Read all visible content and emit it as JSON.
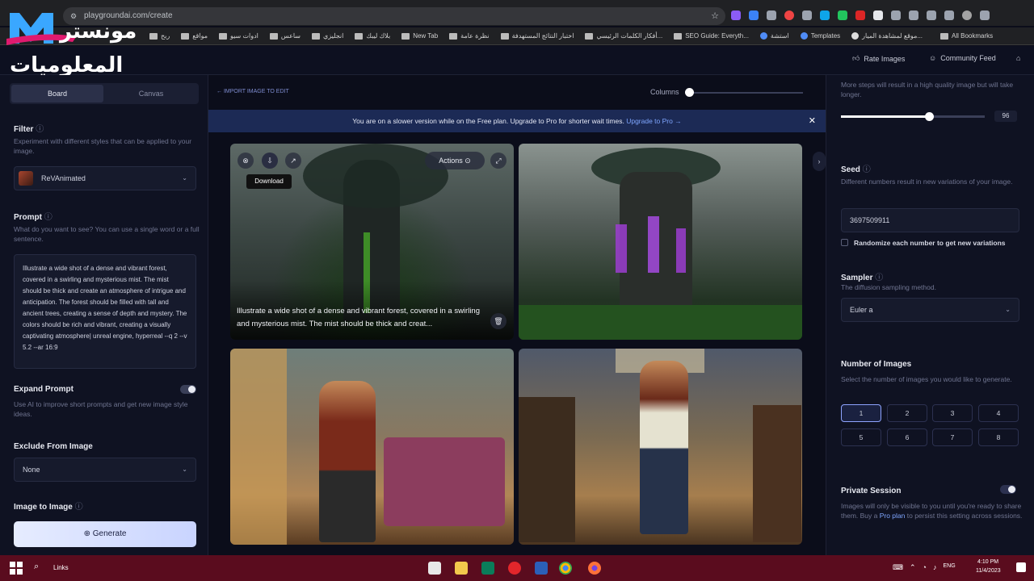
{
  "browser": {
    "url": "playgroundai.com/create",
    "bookmarks": [
      "ربح",
      "مواقع",
      "ادوات سيو",
      "ساعس",
      "انجليزي",
      "بلاك ليبك",
      "New Tab",
      "نظرة عامة",
      "اختبار النتائج المستهدفة",
      "أفكار الكلمات الرئيسي...",
      "SEO Guide: Everyth...",
      "استشة",
      "Templates",
      "موقع لمشاهدة الميار...",
      "All Bookmarks"
    ]
  },
  "logo": {
    "line1": "مونستر",
    "line2": "المعلوميات"
  },
  "header": {
    "rate_images": "Rate Images",
    "community_feed": "Community Feed"
  },
  "left": {
    "tabs": {
      "board": "Board",
      "canvas": "Canvas"
    },
    "filter": {
      "label": "Filter",
      "desc": "Experiment with different styles that can be applied to your image.",
      "value": "ReVAnimated"
    },
    "prompt": {
      "label": "Prompt",
      "desc": "What do you want to see? You can use a single word or a full sentence.",
      "text": "Illustrate a wide shot of a dense and vibrant forest, covered in a swirling and mysterious mist. The mist should be thick and create an atmosphere of intrigue and anticipation. The forest should be filled with tall and ancient trees, creating a sense of depth and mystery. The colors should be rich and vibrant, creating a visually captivating atmosphere| unreal engine, hyperreal --q 2 --v 5.2 --ar 16:9"
    },
    "expand": {
      "label": "Expand Prompt",
      "desc": "Use AI to improve short prompts and get new image style ideas."
    },
    "exclude": {
      "label": "Exclude From Image",
      "value": "None"
    },
    "img2img": {
      "label": "Image to Image"
    },
    "generate": "Generate"
  },
  "center": {
    "import_link": "← IMPORT IMAGE TO EDIT",
    "columns_label": "Columns",
    "notice": "You are on a slower version while on the Free plan. Upgrade to Pro for shorter wait times.",
    "notice_link": "Upgrade to Pro →",
    "actions_label": "Actions",
    "tooltip": "Download",
    "caption": "Illustrate a wide shot of a dense and vibrant forest, covered in a swirling and mysterious mist. The mist should be thick and creat..."
  },
  "right": {
    "steps_desc": "More steps will result in a high quality image but will take longer.",
    "steps_value": "96",
    "seed": {
      "label": "Seed",
      "desc": "Different numbers result in new variations of your image.",
      "value": "3697509911",
      "randomize": "Randomize each number to get new variations"
    },
    "sampler": {
      "label": "Sampler",
      "desc": "The diffusion sampling method.",
      "value": "Euler a"
    },
    "num_images": {
      "label": "Number of Images",
      "desc": "Select the number of images you would like to generate.",
      "options": [
        "1",
        "2",
        "3",
        "4",
        "5",
        "6",
        "7",
        "8"
      ],
      "selected": "1"
    },
    "private": {
      "label": "Private Session",
      "desc1": "Images will only be visible to you until you're ready to share them. Buy a ",
      "link": "Pro plan",
      "desc2": " to persist this setting across sessions."
    }
  },
  "taskbar": {
    "search": "Links",
    "lang": "ENG",
    "time": "4:10 PM",
    "date": "11/4/2023"
  }
}
